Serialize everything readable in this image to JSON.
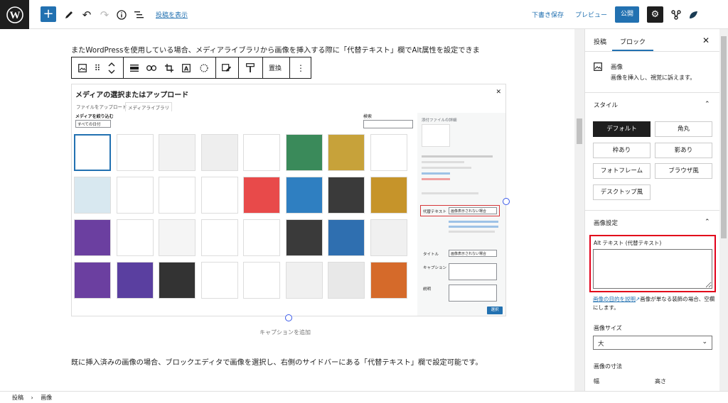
{
  "topbar": {
    "view_post": "投稿を表示",
    "save_draft": "下書き保存",
    "preview": "プレビュー",
    "publish": "公開"
  },
  "editor": {
    "paragraph1": "またWordPressを使用している場合、メディアライブラリから画像を挿入する際に「代替テキスト」欄でAlt属性を設定できま",
    "toolbar_replace": "置換",
    "caption_placeholder": "キャプションを追加",
    "paragraph2": "既に挿入済みの画像の場合、ブロックエディタで画像を選択し、右側のサイドバーにある「代替テキスト」欄で設定可能です。"
  },
  "media_modal": {
    "title": "メディアの選択またはアップロード",
    "tab_upload": "ファイルをアップロード",
    "tab_library": "メディアライブラリ",
    "filter_label": "メディアを絞り込む",
    "date_filter": "すべての日付",
    "search_label": "検索",
    "attachment_details": "添付ファイルの詳細",
    "alt_label": "代替テキスト",
    "alt_value": "画像表示されない場合",
    "title_label": "タイトル",
    "title_value": "画像表示されない場合",
    "caption_label": "キャプション",
    "description_label": "説明",
    "select_button": "選択",
    "thumb_colors": [
      "#ffffff",
      "#ffffff",
      "#f2f2f2",
      "#eeeeee",
      "#ffffff",
      "#3a8a5a",
      "#c7a23a",
      "#ffffff",
      "#d8e8f0",
      "#ffffff",
      "#ffffff",
      "#ffffff",
      "#e84a4a",
      "#2f7fc1",
      "#3a3a3a",
      "#c6942a",
      "#6b3fa0",
      "#ffffff",
      "#f5f5f5",
      "#ffffff",
      "#ffffff",
      "#3a3a3a",
      "#2f6fb0",
      "#f0f0f0",
      "#6b3fa0",
      "#5a3fa0",
      "#333333",
      "#ffffff",
      "#ffffff",
      "#f0f0f0",
      "#e8e8e8",
      "#d56a2a",
      "#ffffff",
      "#ffffff"
    ]
  },
  "sidebar": {
    "tab_post": "投稿",
    "tab_block": "ブロック",
    "block_name": "画像",
    "block_desc": "画像を挿入し、視覚に訴えます。",
    "styles_title": "スタイル",
    "styles": [
      "デフォルト",
      "角丸",
      "枠あり",
      "影あり",
      "フォトフレーム",
      "ブラウザ風",
      "デスクトップ風"
    ],
    "image_settings_title": "画像設定",
    "alt_text_title": "Alt テキスト (代替テキスト)",
    "alt_help_link": "画像の目的を説明",
    "alt_help_text": "画像が単なる装飾の場合、空欄にします。",
    "image_size_title": "画像サイズ",
    "image_size_value": "大",
    "dimensions_title": "画像の寸法",
    "width_label": "幅",
    "height_label": "高さ"
  },
  "breadcrumb": {
    "item1": "投稿",
    "separator": "›",
    "item2": "画像"
  }
}
